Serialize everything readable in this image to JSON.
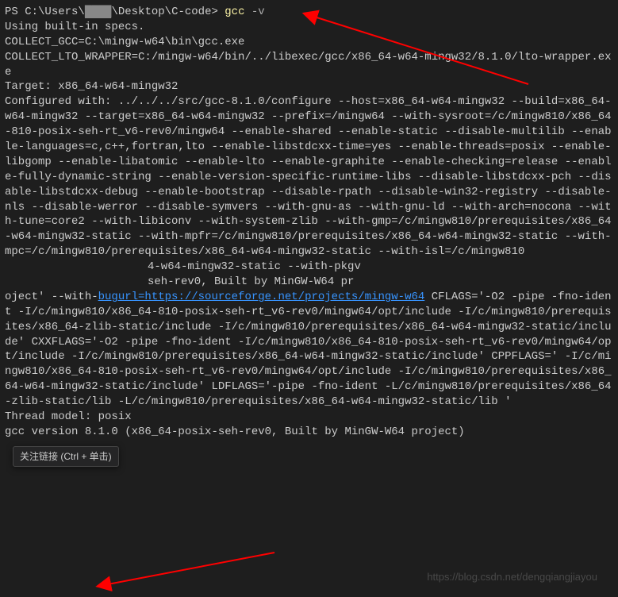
{
  "prompt": {
    "prefix": "PS ",
    "path_start": "C:\\Users\\",
    "path_redacted": "████",
    "path_end": "\\Desktop\\C-code>",
    "command": "gcc",
    "arg": " -v"
  },
  "output_body": "Using built-in specs.\nCOLLECT_GCC=C:\\mingw-w64\\bin\\gcc.exe\nCOLLECT_LTO_WRAPPER=C:/mingw-w64/bin/../libexec/gcc/x86_64-w64-mingw32/8.1.0/lto-wrapper.exe\nTarget: x86_64-w64-mingw32\nConfigured with: ../../../src/gcc-8.1.0/configure --host=x86_64-w64-mingw32 --build=x86_64-w64-mingw32 --target=x86_64-w64-mingw32 --prefix=/mingw64 --with-sysroot=/c/mingw810/x86_64-810-posix-seh-rt_v6-rev0/mingw64 --enable-shared --enable-static --disable-multilib --enable-languages=c,c++,fortran,lto --enable-libstdcxx-time=yes --enable-threads=posix --enable-libgomp --enable-libatomic --enable-lto --enable-graphite --enable-checking=release --enable-fully-dynamic-string --enable-version-specific-runtime-libs --disable-libstdcxx-pch --disable-libstdcxx-debug --enable-bootstrap --disable-rpath --disable-win32-registry --disable-nls --disable-werror --disable-symvers --with-gnu-as --with-gnu-ld --with-arch=nocona --with-tune=core2 --with-libiconv --with-system-zlib --with-gmp=/c/mingw810/prerequisites/x86_64-w64-mingw32-static --with-mpfr=/c/mingw810/prerequisites/x86_64-w64-mingw32-static --with-mpc=/c/mingw810/prerequisites/x86_64-w64-mingw32-static --with-isl=/c/mingw810",
  "output_mid1": "4-w64-mingw32-static --with-pkgv",
  "output_mid2": "seh-rev0, Built by MinGW-W64 pr",
  "output_after_link_pre": "oject' --with-",
  "link_text": "bugurl=https://sourceforge.net/projects/mingw-w64",
  "output_tail": " CFLAGS='-O2 -pipe -fno-ident -I/c/mingw810/x86_64-810-posix-seh-rt_v6-rev0/mingw64/opt/include -I/c/mingw810/prerequisites/x86_64-zlib-static/include -I/c/mingw810/prerequisites/x86_64-w64-mingw32-static/include' CXXFLAGS='-O2 -pipe -fno-ident -I/c/mingw810/x86_64-810-posix-seh-rt_v6-rev0/mingw64/opt/include -I/c/mingw810/prerequisites/x86_64-w64-mingw32-static/include' CPPFLAGS=' -I/c/mingw810/x86_64-810-posix-seh-rt_v6-rev0/mingw64/opt/include -I/c/mingw810/prerequisites/x86_64-w64-mingw32-static/include' LDFLAGS='-pipe -fno-ident -L/c/mingw810/prerequisites/x86_64-zlib-static/lib -L/c/mingw810/prerequisites/x86_64-w64-mingw32-static/lib '\nThread model: posix\ngcc version 8.1.0 (x86_64-posix-seh-rev0, Built by MinGW-W64 project)",
  "tooltip": "关注链接 (Ctrl + 单击)",
  "watermark": "https://blog.csdn.net/dengqiangjiayou"
}
